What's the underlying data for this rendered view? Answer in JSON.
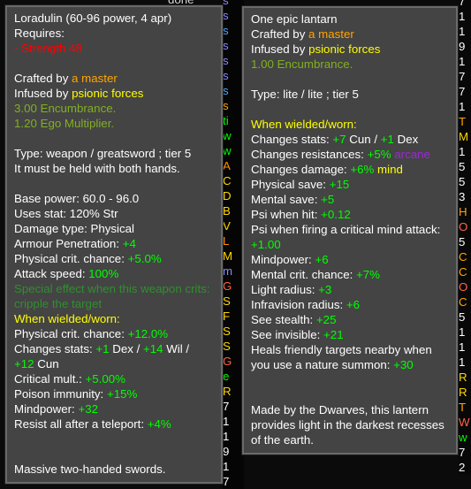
{
  "background": {
    "top_strip_text": "done",
    "mid_column": [
      {
        "t": "s",
        "c": "#8b8bff"
      },
      {
        "t": "s",
        "c": "#8b8bff"
      },
      {
        "t": "s",
        "c": "#4aa8ff"
      },
      {
        "t": "s",
        "c": "#8b8bff"
      },
      {
        "t": "s",
        "c": "#8b8bff"
      },
      {
        "t": "s",
        "c": "#8b8bff"
      },
      {
        "t": "s",
        "c": "#4aa8ff"
      },
      {
        "t": "s",
        "c": "#ffa500"
      },
      {
        "t": "ti",
        "c": "#00ff00"
      },
      {
        "t": "w",
        "c": "#00ff00"
      },
      {
        "t": "w",
        "c": "#00ff00"
      },
      {
        "t": "A",
        "c": "#ff8c00"
      },
      {
        "t": "C",
        "c": "#ffd700"
      },
      {
        "t": "D",
        "c": "#ffd700"
      },
      {
        "t": "B",
        "c": "#ffd700"
      },
      {
        "t": "V",
        "c": "#ffd700"
      },
      {
        "t": "L",
        "c": "#ff8c00"
      },
      {
        "t": "M",
        "c": "#ffd700"
      },
      {
        "t": "m",
        "c": "#8b8bff"
      },
      {
        "t": "G",
        "c": "#ff6347"
      },
      {
        "t": "S",
        "c": "#ffd700"
      },
      {
        "t": "F",
        "c": "#ffd700"
      },
      {
        "t": "S",
        "c": "#ffd700"
      },
      {
        "t": "S",
        "c": "#ffd700"
      },
      {
        "t": "G",
        "c": "#ff6347"
      },
      {
        "t": "e",
        "c": "#00ff00"
      },
      {
        "t": "R",
        "c": "#ffd700"
      },
      {
        "t": "7",
        "c": "#ffffff"
      },
      {
        "t": "1",
        "c": "#ffffff"
      },
      {
        "t": "1",
        "c": "#ffffff"
      },
      {
        "t": "9",
        "c": "#ffffff"
      },
      {
        "t": "1",
        "c": "#ffffff"
      },
      {
        "t": "7",
        "c": "#ffffff"
      }
    ],
    "right_column": [
      {
        "t": "7",
        "c": "#ffffff"
      },
      {
        "t": "1",
        "c": "#ffffff"
      },
      {
        "t": "1",
        "c": "#ffffff"
      },
      {
        "t": "9",
        "c": "#ffffff"
      },
      {
        "t": "1",
        "c": "#ffffff"
      },
      {
        "t": "7",
        "c": "#ffffff"
      },
      {
        "t": "7",
        "c": "#ffffff"
      },
      {
        "t": "1",
        "c": "#ffffff"
      },
      {
        "t": "T",
        "c": "#ffa500"
      },
      {
        "t": "M",
        "c": "#ffd700"
      },
      {
        "t": "1",
        "c": "#ffffff"
      },
      {
        "t": "5",
        "c": "#ffffff"
      },
      {
        "t": "5",
        "c": "#ffffff"
      },
      {
        "t": "3",
        "c": "#ffffff"
      },
      {
        "t": "H",
        "c": "#ffa500"
      },
      {
        "t": "O",
        "c": "#ff6347"
      },
      {
        "t": "5",
        "c": "#ffffff"
      },
      {
        "t": "C",
        "c": "#ffa500"
      },
      {
        "t": "C",
        "c": "#ffa500"
      },
      {
        "t": "O",
        "c": "#ff6347"
      },
      {
        "t": "C",
        "c": "#ffa500"
      },
      {
        "t": "5",
        "c": "#ffffff"
      },
      {
        "t": "1",
        "c": "#ffffff"
      },
      {
        "t": "1",
        "c": "#ffffff"
      },
      {
        "t": "1",
        "c": "#ffffff"
      },
      {
        "t": "R",
        "c": "#ffd700"
      },
      {
        "t": "R",
        "c": "#ffd700"
      },
      {
        "t": "T",
        "c": "#ffa500"
      },
      {
        "t": "W",
        "c": "#ff6347"
      },
      {
        "t": "w",
        "c": "#00ff00"
      },
      {
        "t": "7",
        "c": "#ffffff"
      },
      {
        "t": "2",
        "c": "#ffffff"
      }
    ]
  },
  "left_tooltip": {
    "name": "Loradulin (60-96 power, 4 apr)",
    "requires_label": "Requires:",
    "requirement": "- Strength 48",
    "crafted_by_prefix": "Crafted by ",
    "crafted_by": "a master",
    "infused_by_prefix": "Infused by ",
    "infused_by": "psionic forces",
    "encumbrance": "3.00 Encumbrance.",
    "ego_multiplier": "1.20 Ego Multiplier.",
    "type_line": "Type: weapon / greatsword ; tier 5",
    "hands_line": "It must be held with both hands.",
    "base_power": "Base power: 60.0 - 96.0",
    "uses_stat": "Uses stat: 120% Str",
    "damage_type": "Damage type: Physical",
    "armour_pen_label": "Armour Penetration: ",
    "armour_pen_value": "+4",
    "phys_crit_label": "Physical crit. chance: ",
    "phys_crit_value": "+5.0%",
    "attack_speed_label": "Attack speed: ",
    "attack_speed_value": "100%",
    "special_effect": "Special effect when this weapon crits: cripple the target",
    "wielded_header": "When wielded/worn:",
    "w_phys_crit_label": "Physical crit. chance: ",
    "w_phys_crit_value": "+12.0%",
    "changes_stats_label": "Changes stats: ",
    "stat_dex_value": "+1",
    "stat_dex_name": " Dex / ",
    "stat_wil_value": "+14",
    "stat_wil_name": " Wil /",
    "stat_cun_value": "+12",
    "stat_cun_name": " Cun",
    "critical_mult_label": "Critical mult.: ",
    "critical_mult_value": "+5.00%",
    "poison_label": "Poison immunity: ",
    "poison_value": "+15%",
    "mindpower_label": "Mindpower: ",
    "mindpower_value": "+32",
    "resist_label": "Resist all after a teleport: ",
    "resist_value": "+4%",
    "description": "Massive two-handed swords."
  },
  "right_tooltip": {
    "name": "One epic lantarn",
    "crafted_by_prefix": "Crafted by ",
    "crafted_by": "a master",
    "infused_by_prefix": "Infused by ",
    "infused_by": "psionic forces",
    "encumbrance": "1.00 Encumbrance.",
    "type_line": "Type: lite / lite ; tier 5",
    "wielded_header": "When wielded/worn:",
    "changes_stats_label": "Changes stats: ",
    "stat_cun_value": "+7",
    "stat_cun_name": " Cun / ",
    "stat_dex_value": "+1",
    "stat_dex_name": " Dex",
    "resist_label": "Changes resistances: ",
    "resist_value": "+5%",
    "resist_type": " arcane",
    "damage_label": "Changes damage: ",
    "damage_value": "+6%",
    "damage_type": " mind",
    "phys_save_label": "Physical save: ",
    "phys_save_value": "+15",
    "mental_save_label": "Mental save: ",
    "mental_save_value": "+5",
    "psi_hit_label": "Psi when hit: ",
    "psi_hit_value": "+0.12",
    "psi_crit_label": "Psi when firing a critical mind attack:",
    "psi_crit_value": "+1.00",
    "mindpower_label": "Mindpower: ",
    "mindpower_value": "+6",
    "mental_crit_label": "Mental crit. chance: ",
    "mental_crit_value": "+7%",
    "light_radius_label": "Light radius: ",
    "light_radius_value": "+3",
    "infravision_label": "Infravision radius: ",
    "infravision_value": "+6",
    "see_stealth_label": "See stealth: ",
    "see_stealth_value": "+25",
    "see_invisible_label": "See invisible: ",
    "see_invisible_value": "+21",
    "heals_text": "Heals friendly targets nearby when you use a nature summon: ",
    "heals_value": "+30",
    "description": "Made by the Dwarves, this lantern provides light in the darkest recesses of the earth."
  }
}
